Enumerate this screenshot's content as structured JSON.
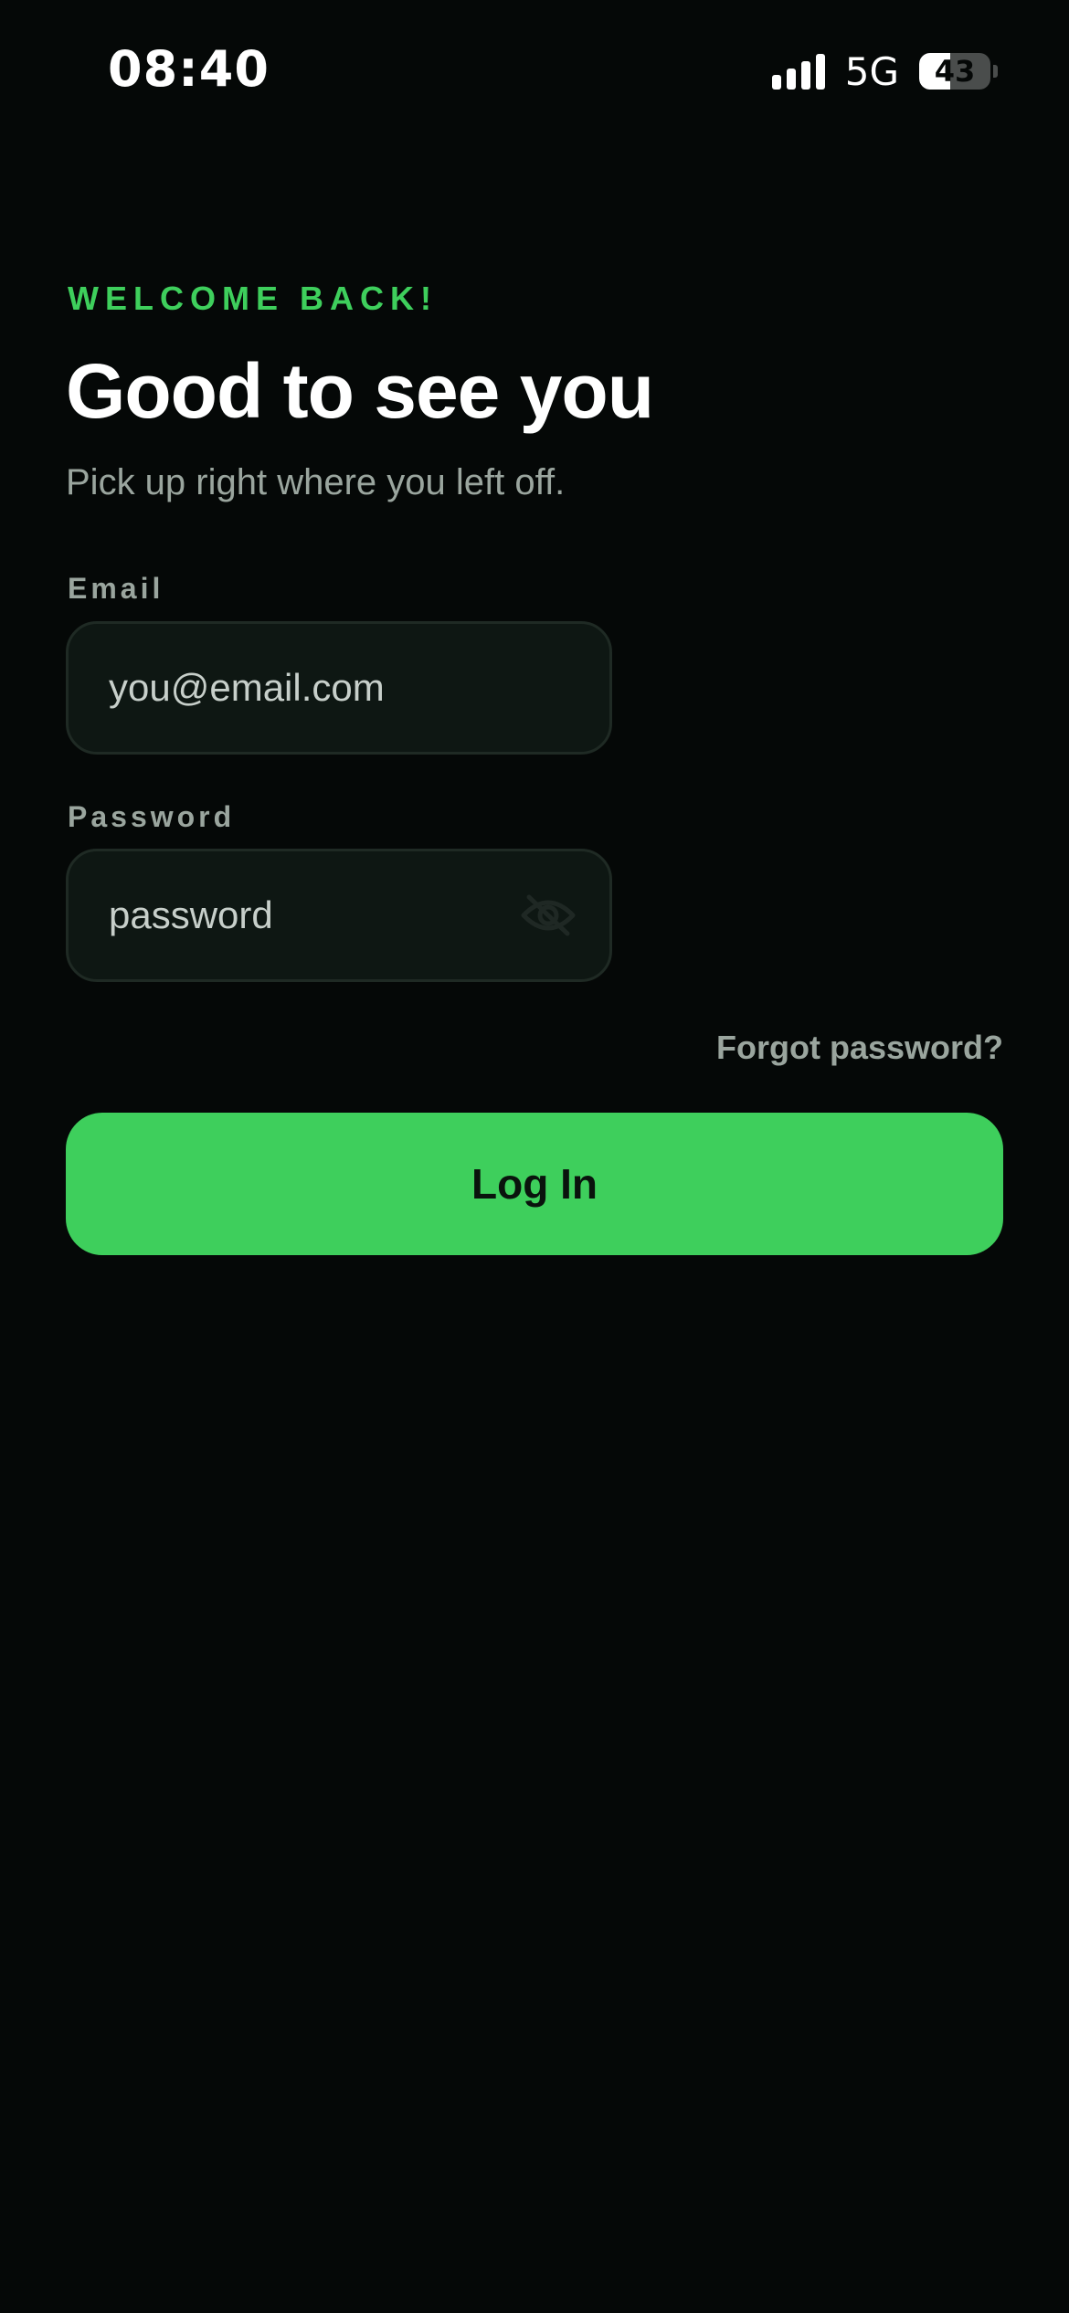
{
  "status_bar": {
    "time": "08:40",
    "network": "5G",
    "battery_level": "43",
    "battery_fraction": 0.43,
    "signal_bars": 4
  },
  "login": {
    "eyebrow": "WELCOME BACK!",
    "title": "Good to see you",
    "subtitle": "Pick up right where you left off.",
    "email_label": "Email",
    "email_placeholder": "you@email.com",
    "password_label": "Password",
    "password_placeholder": "password",
    "password_toggle_icon": "eye-off-icon",
    "forgot_label": "Forgot password?",
    "login_label": "Log In"
  },
  "colors": {
    "background": "#050807",
    "accent": "#3ecf5c",
    "muted_text": "#9aa59e",
    "input_background": "#0e1713",
    "input_border": "#1f2a24"
  }
}
